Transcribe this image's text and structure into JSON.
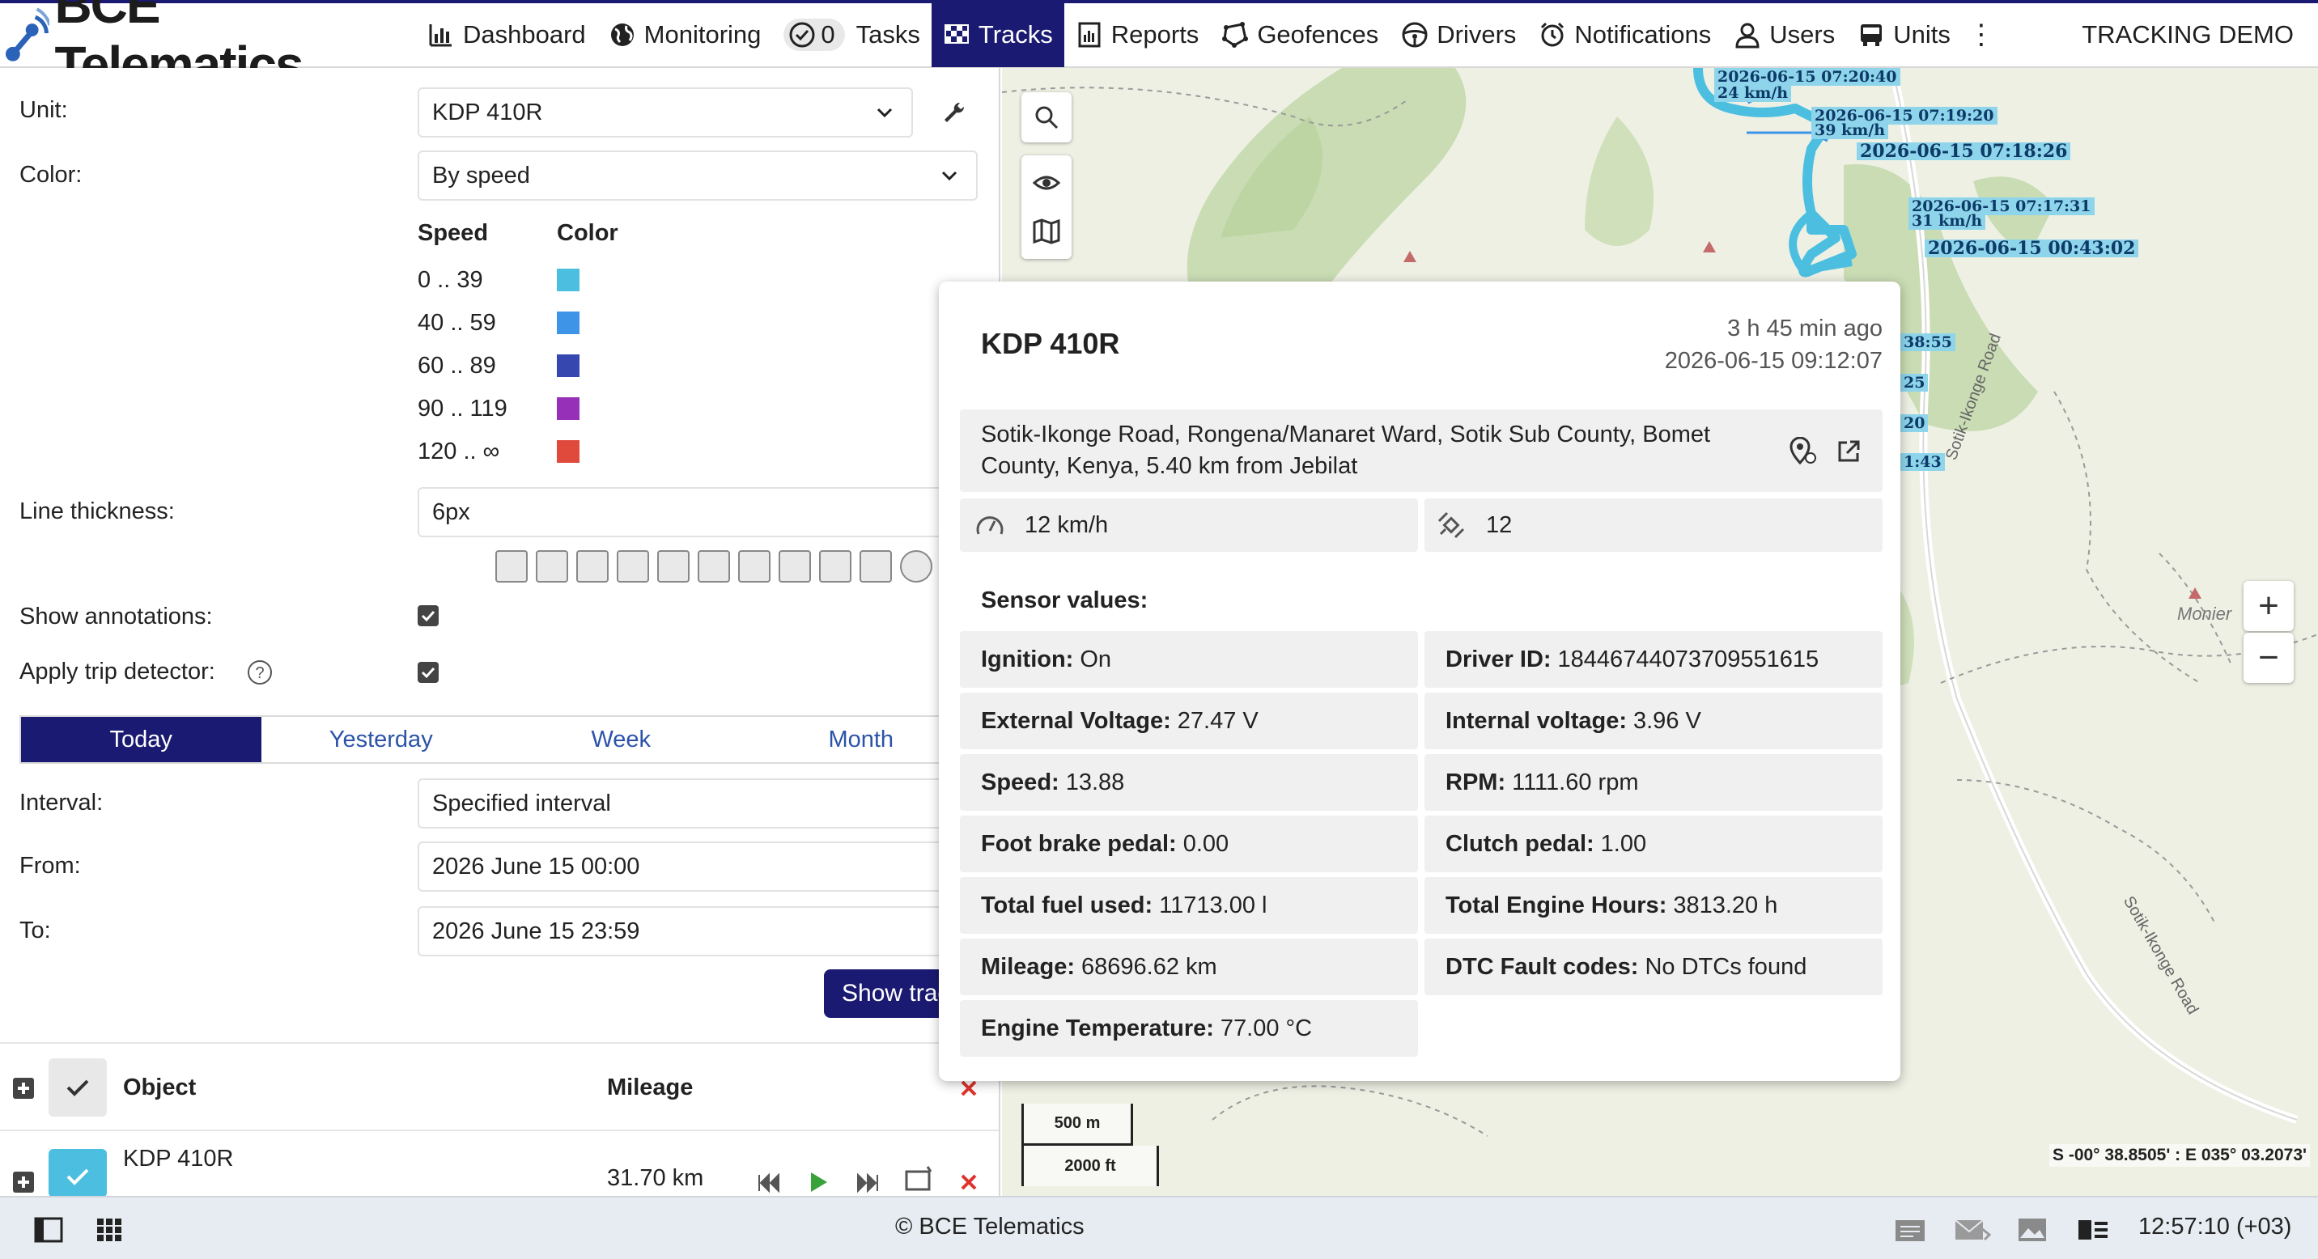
{
  "app": {
    "brand": "BCE Telematics",
    "tracking_label": "TRACKING DEMO",
    "accent": "#1b1a72"
  },
  "nav": {
    "dashboard": "Dashboard",
    "monitoring": "Monitoring",
    "tasks_count": "0",
    "tasks": "Tasks",
    "tracks": "Tracks",
    "reports": "Reports",
    "geofences": "Geofences",
    "drivers": "Drivers",
    "notifications": "Notifications",
    "users": "Users",
    "units": "Units",
    "more": "⋮"
  },
  "panel": {
    "unit_label": "Unit:",
    "unit_value": "KDP 410R",
    "color_label": "Color:",
    "color_value": "By speed",
    "legend": {
      "speed_header": "Speed",
      "color_header": "Color",
      "rows": [
        {
          "range": "0 .. 39",
          "color": "#4cbfe0"
        },
        {
          "range": "40 .. 59",
          "color": "#3e95e8"
        },
        {
          "range": "60 .. 89",
          "color": "#3747b0"
        },
        {
          "range": "90 .. 119",
          "color": "#9630b8"
        },
        {
          "range": "120 .. ∞",
          "color": "#e04a3c"
        }
      ]
    },
    "thickness_label": "Line thickness:",
    "thickness_value": "6px",
    "annotations_label": "Show annotations:",
    "annotations_checked": true,
    "trip_label": "Apply trip detector:",
    "trip_checked": true,
    "tabs": [
      "Today",
      "Yesterday",
      "Week",
      "Month"
    ],
    "active_tab": "Today",
    "interval_label": "Interval:",
    "interval_value": "Specified interval",
    "from_label": "From:",
    "from_value": "2026 June 15 00:00",
    "to_label": "To:",
    "to_value": "2026 June 15 23:59",
    "show_button": "Show tracks",
    "object_header": "Object",
    "mileage_header": "Mileage",
    "row": {
      "name": "KDP 410R",
      "mileage": "31.70 km"
    }
  },
  "map": {
    "track_labels": [
      "2026-06-15 07:20:40",
      "24 km/h",
      "2026-06-15 07:19:20",
      "39 km/h",
      "2026-06-15 07:18:26",
      "2026-06-15 07:17:31",
      "31 km/h",
      "2026-06-15 00:43:02",
      "38:55",
      "25",
      "20",
      "1:43"
    ],
    "road_names": [
      "Sotik-Ikonge Road",
      "Sotik-Ikonge Road"
    ],
    "place": "Monier",
    "scale_metric": "500 m",
    "scale_imperial": "2000 ft",
    "coords": "S -00° 38.8505' : E 035° 03.2073'",
    "zoom_in": "+",
    "zoom_out": "−"
  },
  "popup": {
    "title": "KDP 410R",
    "ago": "3 h 45 min ago",
    "timestamp": "2026-06-15 09:12:07",
    "address": "Sotik-Ikonge Road, Rongena/Manaret Ward, Sotik Sub County, Bomet County, Kenya, 5.40 km from Jebilat",
    "speed": "12 km/h",
    "satellites": "12",
    "sensors_title": "Sensor values:",
    "sensors": [
      {
        "name": "Ignition:",
        "value": "On"
      },
      {
        "name": "Driver ID:",
        "value": "18446744073709551615"
      },
      {
        "name": "External Voltage:",
        "value": "27.47 V"
      },
      {
        "name": "Internal voltage:",
        "value": "3.96 V"
      },
      {
        "name": "Speed:",
        "value": "13.88"
      },
      {
        "name": "RPM:",
        "value": "1111.60 rpm"
      },
      {
        "name": "Foot brake pedal:",
        "value": "0.00"
      },
      {
        "name": "Clutch pedal:",
        "value": "1.00"
      },
      {
        "name": "Total fuel used:",
        "value": "11713.00 l"
      },
      {
        "name": "Total Engine Hours:",
        "value": "3813.20 h"
      },
      {
        "name": "Mileage:",
        "value": "68696.62 km"
      },
      {
        "name": "DTC Fault codes:",
        "value": "No DTCs found"
      },
      {
        "name": "Engine Temperature:",
        "value": "77.00 °C"
      }
    ]
  },
  "footer": {
    "copyright": "© BCE Telematics",
    "clock": "12:57:10 (+03)"
  }
}
